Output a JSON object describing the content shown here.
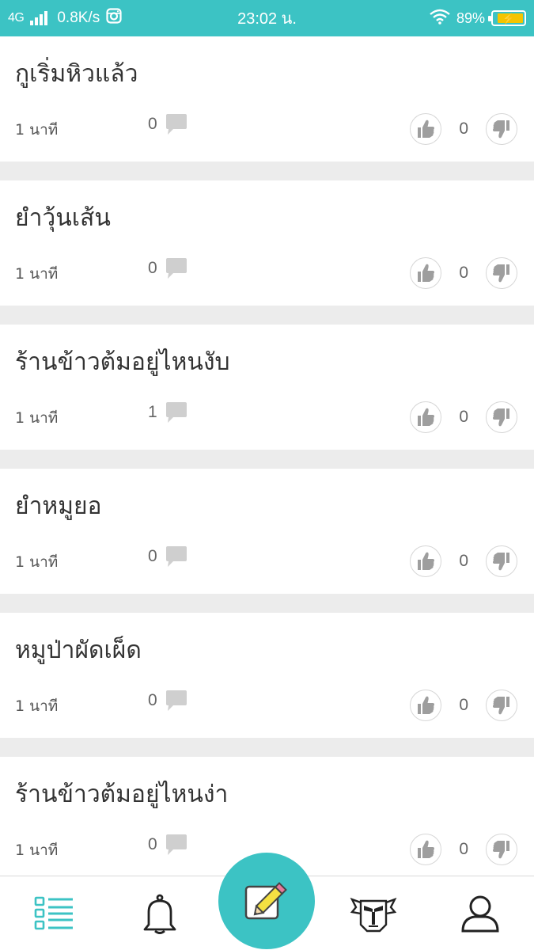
{
  "status_bar": {
    "network": "4G",
    "speed": "0.8K/s",
    "time": "23:02 น.",
    "battery_percent": "89%",
    "battery_level": 0.89,
    "battery_color": "#f5c400"
  },
  "theme": {
    "accent": "#3cc3c4",
    "text": "#333333",
    "muted": "#999999"
  },
  "posts": [
    {
      "title": "กูเริ่มหิวแล้ว",
      "time": "1 นาที",
      "comments": "0",
      "score": "0"
    },
    {
      "title": "ยำวุ้นเส้น",
      "time": "1 นาที",
      "comments": "0",
      "score": "0"
    },
    {
      "title": "ร้านข้าวต้มอยู่ไหนงับ",
      "time": "1 นาที",
      "comments": "1",
      "score": "0"
    },
    {
      "title": "ยำหมูยอ",
      "time": "1 นาที",
      "comments": "0",
      "score": "0"
    },
    {
      "title": "หมูป่าผัดเผ็ด",
      "time": "1 นาที",
      "comments": "0",
      "score": "0"
    },
    {
      "title": "ร้านข้าวต้มอยู่ไหนง่า",
      "time": "1 นาที",
      "comments": "0",
      "score": "0"
    }
  ],
  "icons": {
    "comment": "speech-bubble-icon",
    "upvote": "thumbs-up-icon",
    "downvote": "thumbs-down-icon"
  },
  "nav": {
    "items": [
      "feed-list-icon",
      "bell-icon",
      "compose-pencil-icon",
      "mascot-icon",
      "user-profile-icon"
    ]
  }
}
